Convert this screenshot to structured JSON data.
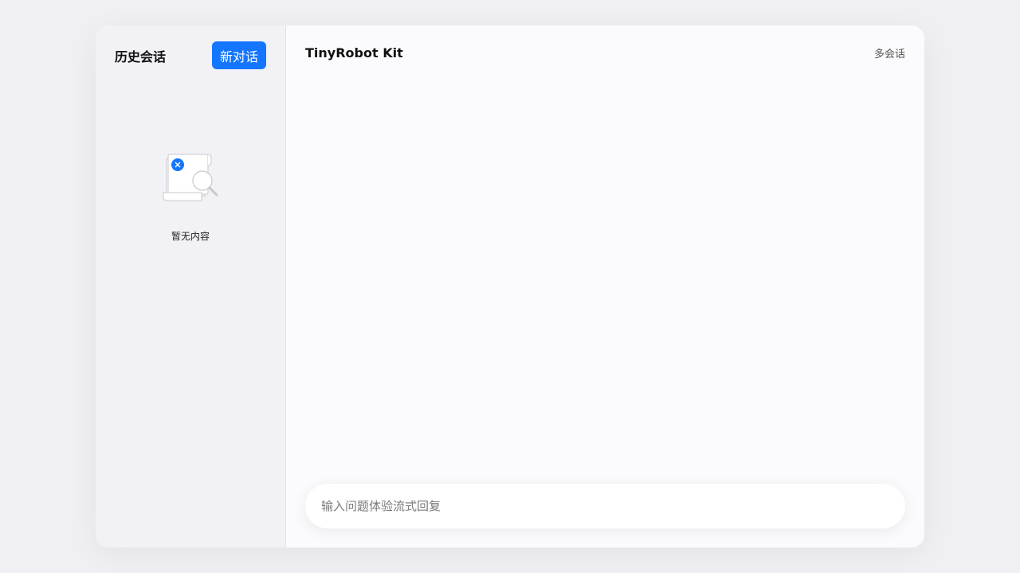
{
  "sidebar": {
    "title": "历史会话",
    "new_button_label": "新对话",
    "empty_text": "暂无内容"
  },
  "main": {
    "title": "TinyRobot Kit",
    "multi_session_label": "多会话"
  },
  "input": {
    "placeholder": "输入问题体验流式回复"
  },
  "colors": {
    "accent": "#1476ff"
  }
}
